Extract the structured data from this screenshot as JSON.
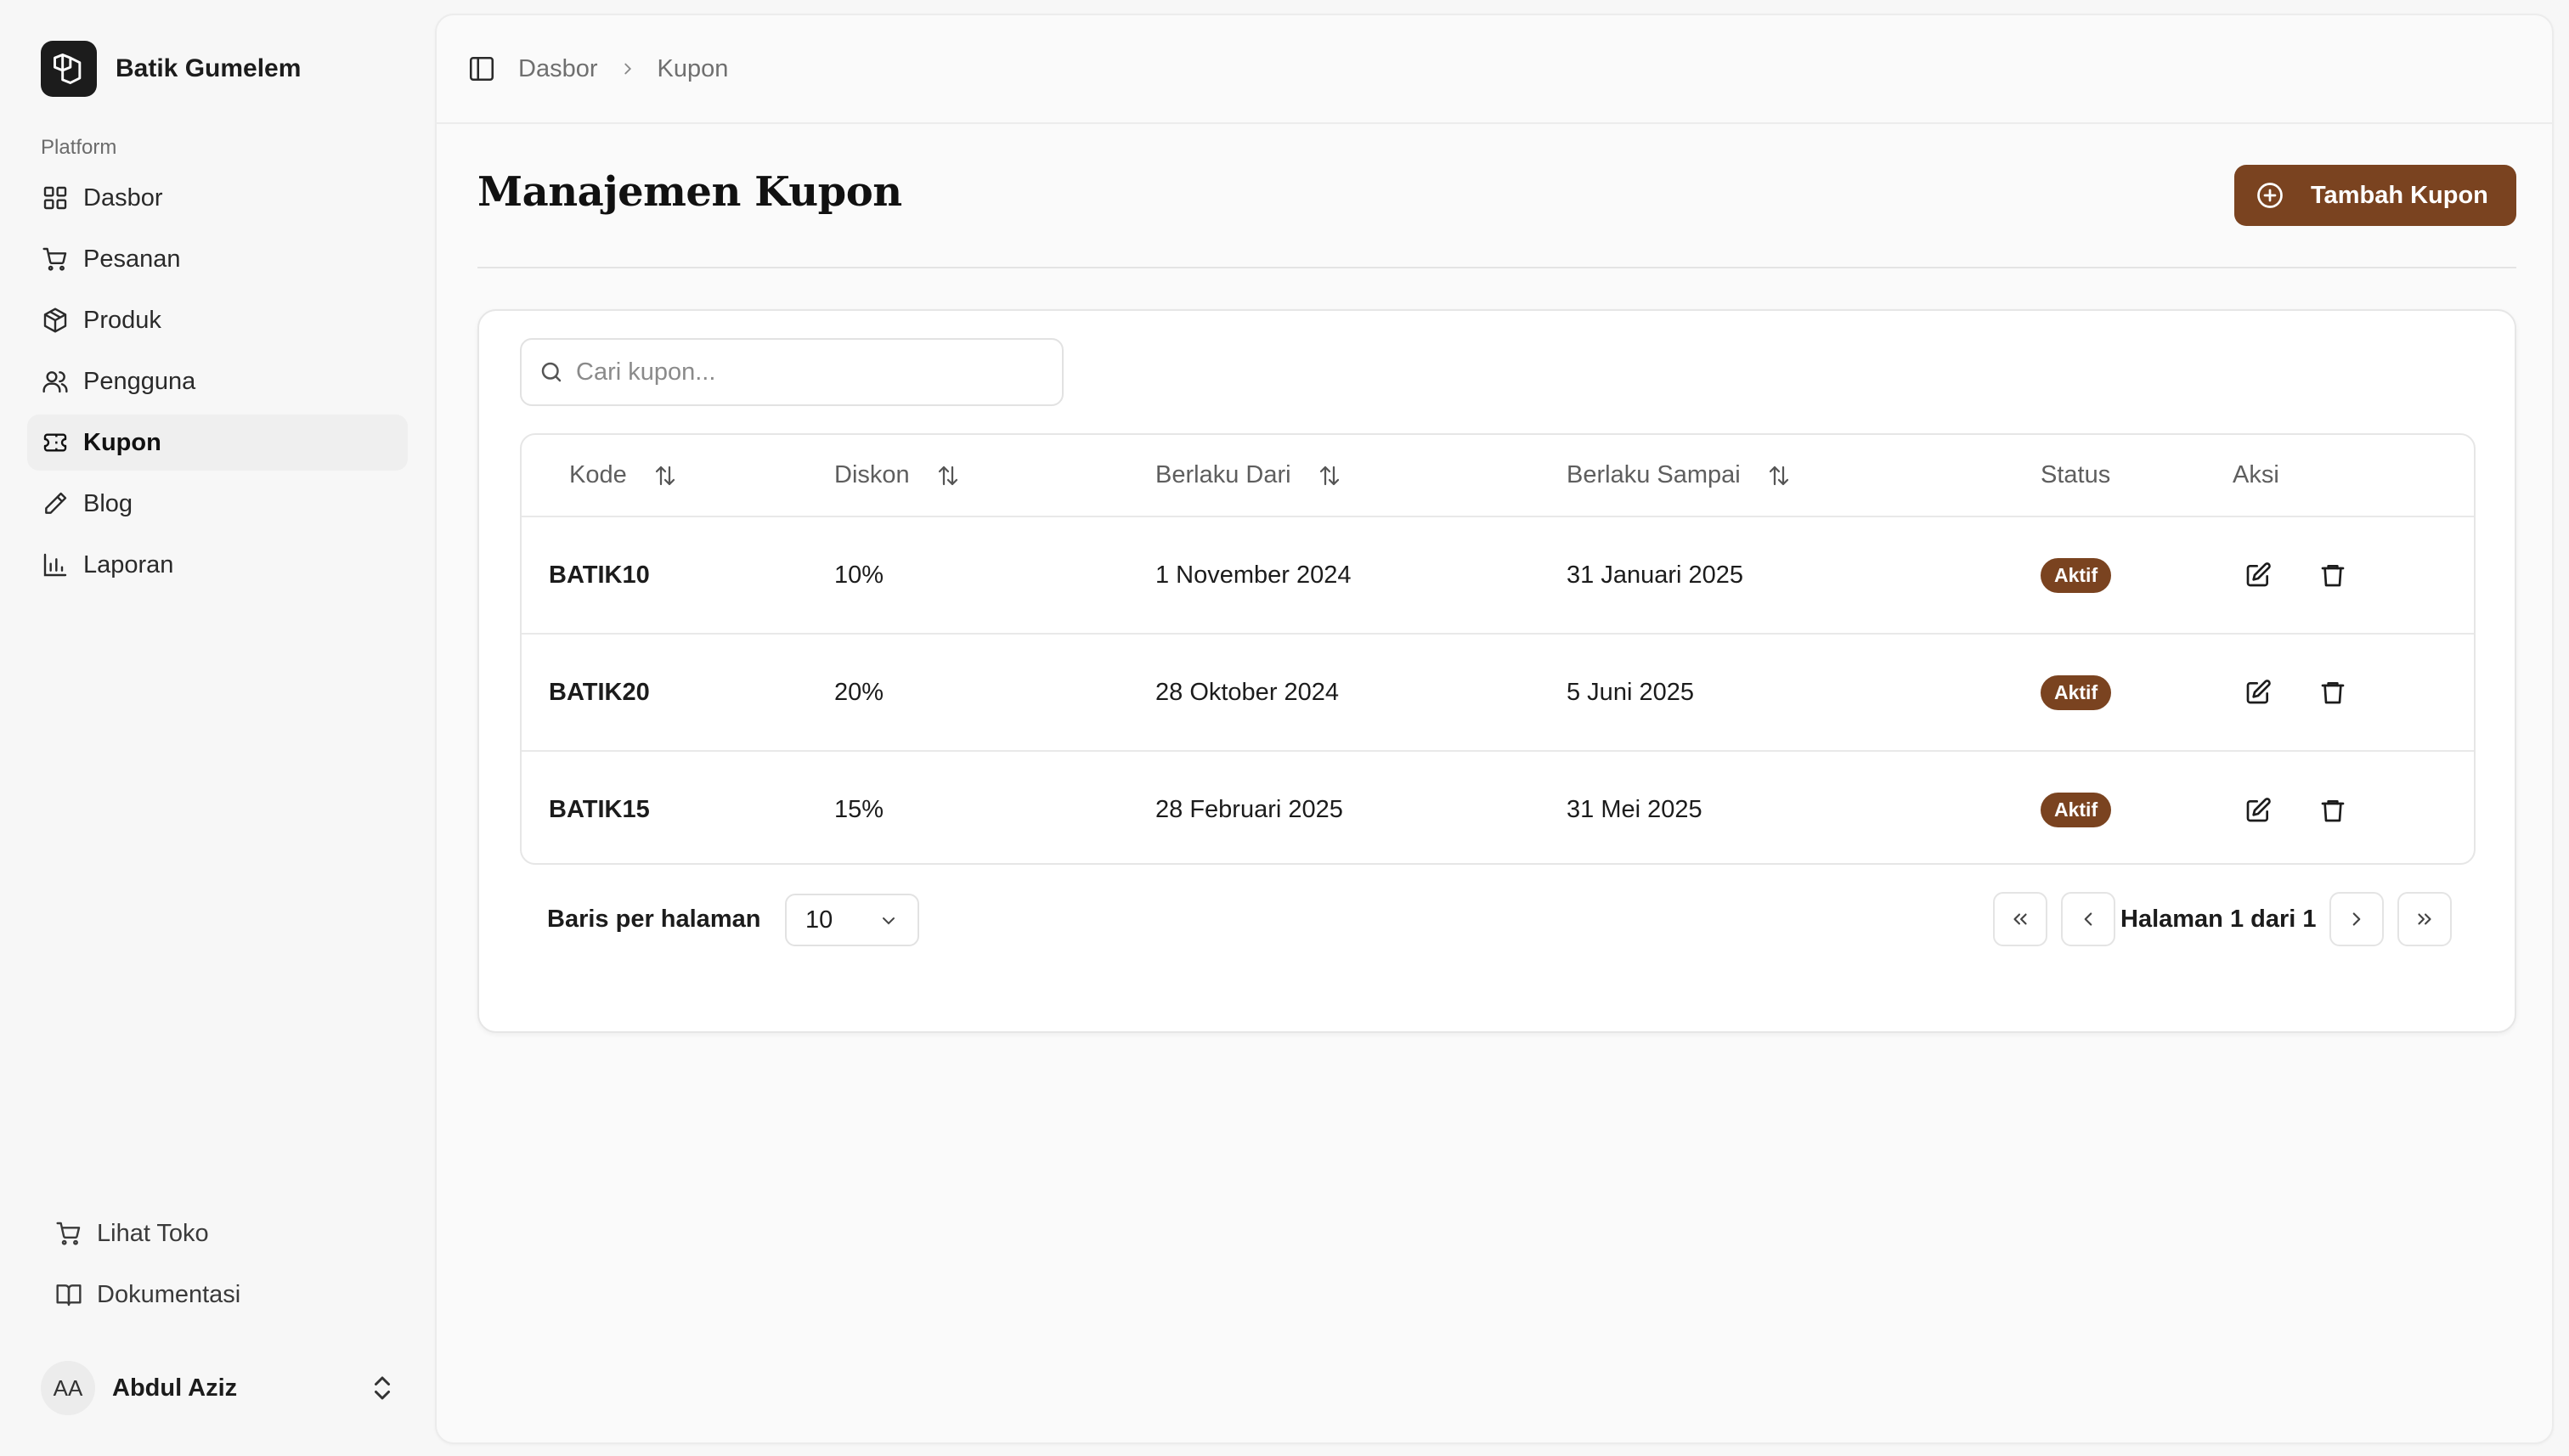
{
  "brand": {
    "name": "Batik Gumelem"
  },
  "sidebar": {
    "group_label": "Platform",
    "items": [
      {
        "label": "Dasbor",
        "icon": "grid-icon",
        "active": false
      },
      {
        "label": "Pesanan",
        "icon": "cart-icon",
        "active": false
      },
      {
        "label": "Produk",
        "icon": "box-icon",
        "active": false
      },
      {
        "label": "Pengguna",
        "icon": "users-icon",
        "active": false
      },
      {
        "label": "Kupon",
        "icon": "ticket-icon",
        "active": true
      },
      {
        "label": "Blog",
        "icon": "pencil-icon",
        "active": false
      },
      {
        "label": "Laporan",
        "icon": "bar-chart-icon",
        "active": false
      }
    ],
    "footer_links": [
      {
        "label": "Lihat Toko",
        "icon": "cart-icon"
      },
      {
        "label": "Dokumentasi",
        "icon": "book-icon"
      }
    ],
    "user": {
      "initials": "AA",
      "name": "Abdul Aziz"
    }
  },
  "breadcrumb": {
    "items": [
      "Dasbor",
      "Kupon"
    ]
  },
  "page": {
    "title": "Manajemen Kupon",
    "add_button_label": "Tambah Kupon"
  },
  "search": {
    "placeholder": "Cari kupon...",
    "value": ""
  },
  "table": {
    "headers": {
      "kode": "Kode",
      "diskon": "Diskon",
      "dari": "Berlaku Dari",
      "sampai": "Berlaku Sampai",
      "status": "Status",
      "aksi": "Aksi"
    },
    "rows": [
      {
        "kode": "BATIK10",
        "diskon": "10%",
        "dari": "1 November 2024",
        "sampai": "31 Januari 2025",
        "status": "Aktif"
      },
      {
        "kode": "BATIK20",
        "diskon": "20%",
        "dari": "28 Oktober 2024",
        "sampai": "5 Juni 2025",
        "status": "Aktif"
      },
      {
        "kode": "BATIK15",
        "diskon": "15%",
        "dari": "28 Februari 2025",
        "sampai": "31 Mei 2025",
        "status": "Aktif"
      }
    ]
  },
  "pagination": {
    "rows_label": "Baris per halaman",
    "rows_value": "10",
    "page_info": "Halaman 1 dari 1"
  },
  "colors": {
    "accent": "#7a4320",
    "text": "#1c1c1c",
    "muted": "#6f6f6f",
    "border": "#e6e6e6"
  }
}
